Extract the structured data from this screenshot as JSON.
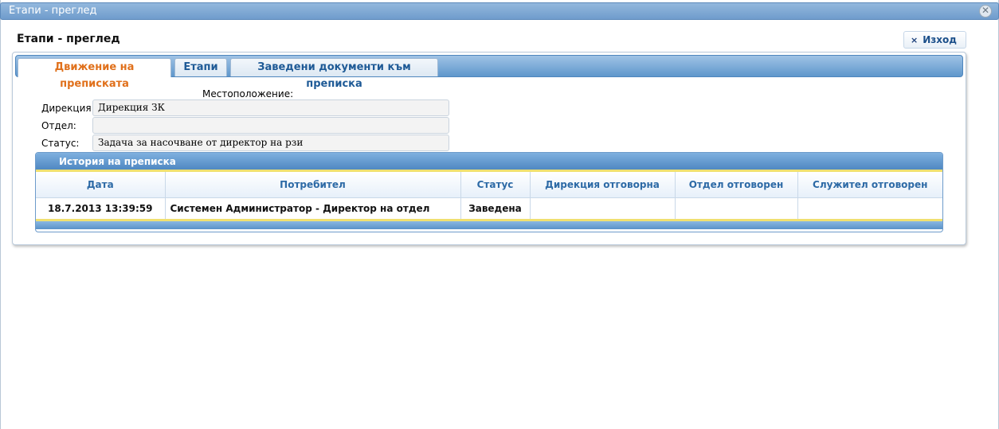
{
  "window": {
    "title": "Етапи - преглед",
    "close_glyph": "✕"
  },
  "page": {
    "title": "Етапи - преглед"
  },
  "exit_button": {
    "label": "Изход",
    "icon_glyph": "×"
  },
  "tabs": [
    {
      "label": "Движение на преписката",
      "active": true
    },
    {
      "label": "Етапи",
      "active": false
    },
    {
      "label": "Заведени документи към преписка",
      "active": false
    }
  ],
  "location": {
    "heading": "Местоположение:",
    "directorate_label": "Дирекция:",
    "directorate_value": "Дирекция ЗК",
    "department_label": "Отдел:",
    "department_value": "",
    "status_label": "Статус:",
    "status_value": "Задача за насочване от директор на рзи"
  },
  "history": {
    "caption": "История на преписка",
    "columns": [
      "Дата",
      "Потребител",
      "Статус",
      "Дирекция отговорна",
      "Отдел отговорен",
      "Служител отговорен"
    ],
    "rows": [
      [
        "18.7.2013 13:39:59",
        "Системен Администратор - Директор на отдел",
        "Заведена",
        "",
        "",
        ""
      ]
    ]
  },
  "colors": {
    "active_tab_text": "#e0701b",
    "tab_text": "#1e5a96",
    "header_blue": "#5f97cc",
    "grid_header_text": "#2d6aa6",
    "accent_yellow": "#f0e070"
  }
}
